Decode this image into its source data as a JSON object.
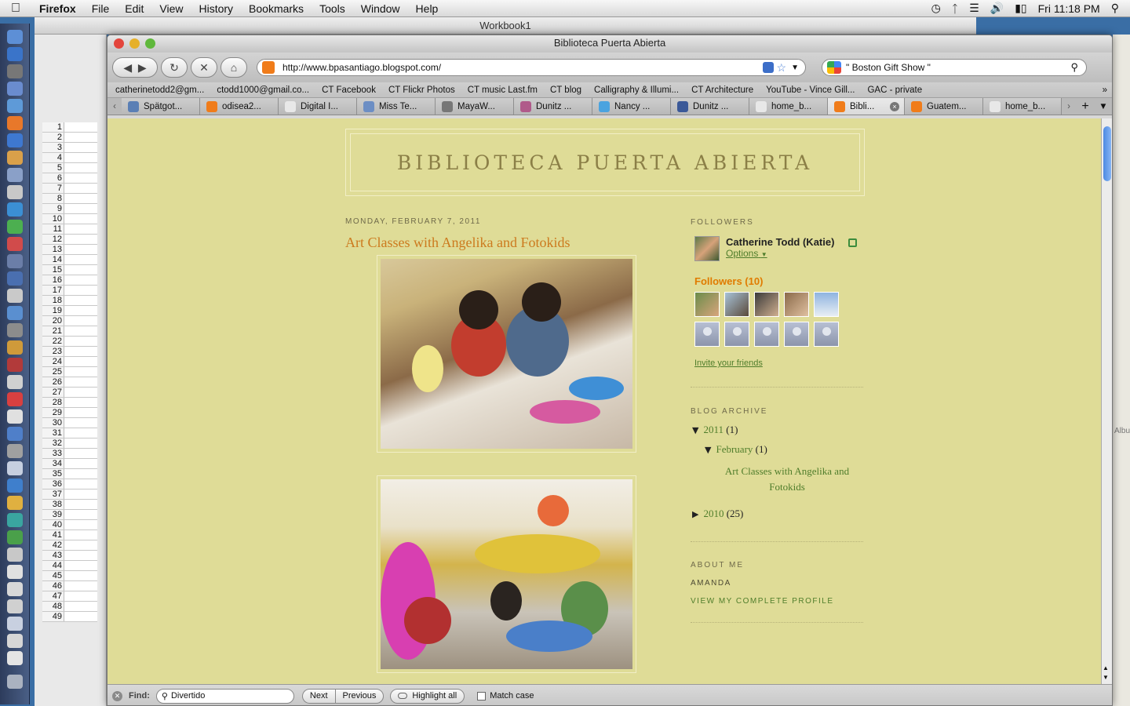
{
  "menubar": {
    "app": "Firefox",
    "menus": [
      "File",
      "Edit",
      "View",
      "History",
      "Bookmarks",
      "Tools",
      "Window",
      "Help"
    ],
    "clock": "Fri 11:18 PM"
  },
  "background": {
    "workbook_title": "Workbook1",
    "row_numbers": [
      "1",
      "2",
      "3",
      "4",
      "5",
      "6",
      "7",
      "8",
      "9",
      "10",
      "11",
      "12",
      "13",
      "14",
      "15",
      "16",
      "17",
      "18",
      "19",
      "20",
      "21",
      "22",
      "23",
      "24",
      "25",
      "26",
      "27",
      "28",
      "29",
      "30",
      "31",
      "32",
      "33",
      "34",
      "35",
      "36",
      "37",
      "38",
      "39",
      "40",
      "41",
      "42",
      "43",
      "44",
      "45",
      "46",
      "47",
      "48",
      "49"
    ],
    "right_label": "Albu"
  },
  "window": {
    "title": "Biblioteca Puerta Abierta"
  },
  "navbar": {
    "url": "http://www.bpasantiago.blogspot.com/",
    "search_query": "\" Boston Gift Show \""
  },
  "bookmarks": [
    "catherinetodd2@gm...",
    "ctodd1000@gmail.co...",
    "CT Facebook",
    "CT Flickr Photos",
    "CT music Last.fm",
    "CT blog",
    "Calligraphy & Illumi...",
    "CT Architecture",
    "YouTube - Vince Gill...",
    "GAC - private"
  ],
  "tabs": [
    {
      "label": "Spätgot...",
      "color": "#5a7fb5"
    },
    {
      "label": "odisea2...",
      "color": "#f07c1a"
    },
    {
      "label": "Digital I...",
      "color": "#e8e8e8"
    },
    {
      "label": "Miss Te...",
      "color": "#6c8ec4"
    },
    {
      "label": "MayaW...",
      "color": "#777777"
    },
    {
      "label": "Dunitz ...",
      "color": "#b05a8a"
    },
    {
      "label": "Nancy ...",
      "color": "#4aa3df"
    },
    {
      "label": "Dunitz ...",
      "color": "#3b5998"
    },
    {
      "label": "home_b...",
      "color": "#e8e8e8"
    },
    {
      "label": "Bibli...",
      "color": "#f07c1a"
    },
    {
      "label": "Guatem...",
      "color": "#f07c1a"
    },
    {
      "label": "home_b...",
      "color": "#e8e8e8"
    }
  ],
  "blog": {
    "title": "BIBLIOTECA PUERTA ABIERTA",
    "post_date": "MONDAY, FEBRUARY 7, 2011",
    "post_title": "Art Classes with Angelika and Fotokids"
  },
  "sidebar": {
    "followers_heading": "FOLLOWERS",
    "me_name": "Catherine Todd (Katie)",
    "me_options": "Options",
    "followers_count": "Followers (10)",
    "invite": "Invite your friends",
    "archive_heading": "BLOG ARCHIVE",
    "archive": {
      "y2011": "2011",
      "y2011_count": "(1)",
      "feb": "February",
      "feb_count": "(1)",
      "post": "Art Classes with Angelika and Fotokids",
      "y2010": "2010",
      "y2010_count": "(25)"
    },
    "about_heading": "ABOUT ME",
    "about_name": "AMANDA",
    "about_profile": "VIEW MY COMPLETE PROFILE"
  },
  "findbar": {
    "label": "Find:",
    "value": "Divertido",
    "next": "Next",
    "previous": "Previous",
    "highlight": "Highlight all",
    "match_case": "Match case"
  },
  "colors": {
    "page_bg": "#dfdc97",
    "title_color": "#8b7f47",
    "post_title": "#cc7a1e",
    "link_green": "#4f7d2b",
    "followers_orange": "#e07b00"
  }
}
